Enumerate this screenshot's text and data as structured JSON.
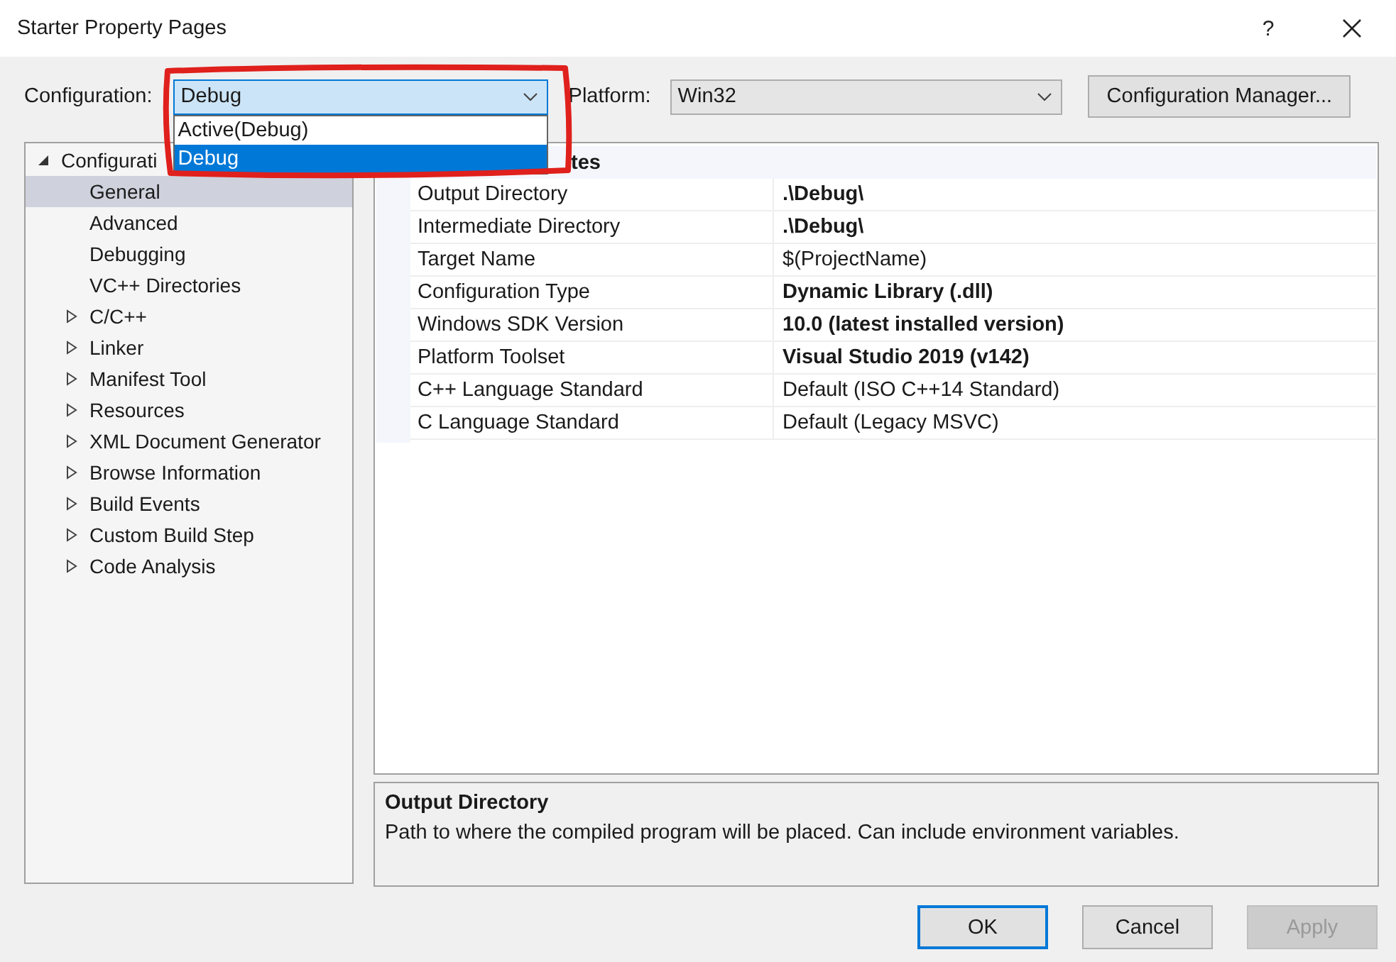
{
  "window": {
    "title": "Starter Property Pages",
    "help": "?"
  },
  "configuration": {
    "label": "Configuration:",
    "value": "Debug",
    "open": true,
    "options": [
      {
        "label": "Active(Debug)",
        "selected": false
      },
      {
        "label": "Debug",
        "selected": true
      }
    ]
  },
  "platform": {
    "label": "Platform:",
    "value": "Win32"
  },
  "configuration_manager": "Configuration Manager...",
  "tree": [
    {
      "label": "Configurati",
      "expanded": true,
      "selected": false,
      "children": [
        {
          "label": "General",
          "selected": true
        },
        {
          "label": "Advanced",
          "selected": false
        },
        {
          "label": "Debugging",
          "selected": false
        },
        {
          "label": "VC++ Directories",
          "selected": false
        },
        {
          "label": "C/C++",
          "expanded": false,
          "selected": false
        },
        {
          "label": "Linker",
          "expanded": false,
          "selected": false
        },
        {
          "label": "Manifest Tool",
          "expanded": false,
          "selected": false
        },
        {
          "label": "Resources",
          "expanded": false,
          "selected": false
        },
        {
          "label": "XML Document Generator",
          "expanded": false,
          "selected": false
        },
        {
          "label": "Browse Information",
          "expanded": false,
          "selected": false
        },
        {
          "label": "Build Events",
          "expanded": false,
          "selected": false
        },
        {
          "label": "Custom Build Step",
          "expanded": false,
          "selected": false
        },
        {
          "label": "Code Analysis",
          "expanded": false,
          "selected": false
        }
      ]
    }
  ],
  "grid": {
    "category": "tes",
    "rows": [
      {
        "name": "Output Directory",
        "value": ".\\Debug\\",
        "bold": true
      },
      {
        "name": "Intermediate Directory",
        "value": ".\\Debug\\",
        "bold": true
      },
      {
        "name": "Target Name",
        "value": "$(ProjectName)",
        "bold": false
      },
      {
        "name": "Configuration Type",
        "value": "Dynamic Library (.dll)",
        "bold": true
      },
      {
        "name": "Windows SDK Version",
        "value": "10.0 (latest installed version)",
        "bold": true
      },
      {
        "name": "Platform Toolset",
        "value": "Visual Studio 2019 (v142)",
        "bold": true
      },
      {
        "name": "C++ Language Standard",
        "value": "Default (ISO C++14 Standard)",
        "bold": false
      },
      {
        "name": "C Language Standard",
        "value": "Default (Legacy MSVC)",
        "bold": false
      }
    ]
  },
  "description": {
    "title": "Output Directory",
    "text": "Path to where the compiled program will be placed. Can include environment variables."
  },
  "buttons": [
    {
      "label": "OK",
      "default": true,
      "disabled": false
    },
    {
      "label": "Cancel",
      "default": false,
      "disabled": false
    },
    {
      "label": "Apply",
      "default": false,
      "disabled": true
    }
  ]
}
